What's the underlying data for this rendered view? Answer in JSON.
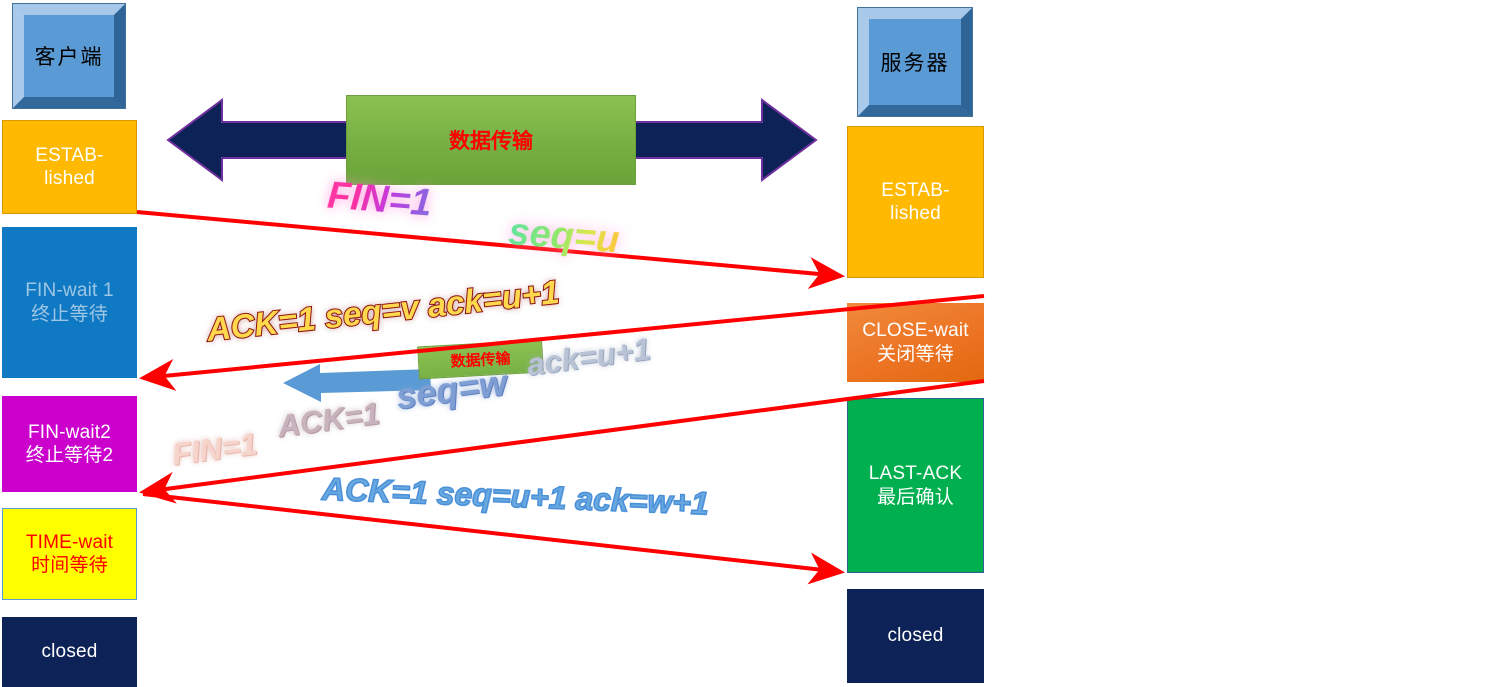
{
  "diagram": {
    "title": "TCP four-way handshake connection termination",
    "endpoints": {
      "client": {
        "label": "客户端"
      },
      "server": {
        "label": "服务器"
      }
    },
    "banners": {
      "big": {
        "label": "数据传输"
      },
      "small": {
        "label": "数据传输"
      }
    },
    "client_states": [
      {
        "name": "established",
        "line1": "ESTAB-",
        "line2": "lished",
        "fill": "#ffb900",
        "text": "#ffffff"
      },
      {
        "name": "fin-wait-1",
        "line1": "FIN-wait 1",
        "line2": "终止等待",
        "fill": "#0f79c4",
        "text": "#9ec6e4"
      },
      {
        "name": "fin-wait-2",
        "line1": "FIN-wait2",
        "line2": "终止等待2",
        "fill": "#cc00cc",
        "text": "#ffffff"
      },
      {
        "name": "time-wait",
        "line1": "TIME-wait",
        "line2": "时间等待",
        "fill": "#ffff00",
        "text": "#ff0000"
      },
      {
        "name": "closed",
        "line1": "closed",
        "line2": "",
        "fill": "#0d2357",
        "text": "#ffffff"
      }
    ],
    "server_states": [
      {
        "name": "established",
        "line1": "ESTAB-",
        "line2": "lished",
        "fill": "#ffb900",
        "text": "#ffffff"
      },
      {
        "name": "close-wait",
        "line1": "CLOSE-wait",
        "line2": "关闭等待",
        "fill": "#ec7424",
        "text": "#ffffff"
      },
      {
        "name": "last-ack",
        "line1": "LAST-ACK",
        "line2": "最后确认",
        "fill": "#00b050",
        "text": "#ffffff"
      },
      {
        "name": "closed",
        "line1": "closed",
        "line2": "",
        "fill": "#0d2357",
        "text": "#ffffff"
      }
    ],
    "messages": [
      {
        "name": "fin-seq-u",
        "direction": "client-to-server",
        "parts": [
          "FIN=1",
          "seq=u"
        ]
      },
      {
        "name": "ack-seq-v-ack-u1",
        "direction": "server-to-client",
        "parts": [
          "ACK=1  seq=v  ack=u+1"
        ]
      },
      {
        "name": "fin-ack-seq-w-ack-u1",
        "direction": "server-to-client",
        "parts": [
          "FIN=1",
          "ACK=1",
          "seq=w",
          "ack=u+1"
        ]
      },
      {
        "name": "ack-seq-u1-ack-w1",
        "direction": "client-to-server",
        "parts": [
          "ACK=1 seq=u+1 ack=w+1"
        ]
      }
    ],
    "colors": {
      "arrow_red": "#ff0000",
      "navy_arrow": "#0d2357",
      "blue_arrow": "#5b9bd5",
      "green_banner": "#76b043"
    }
  }
}
